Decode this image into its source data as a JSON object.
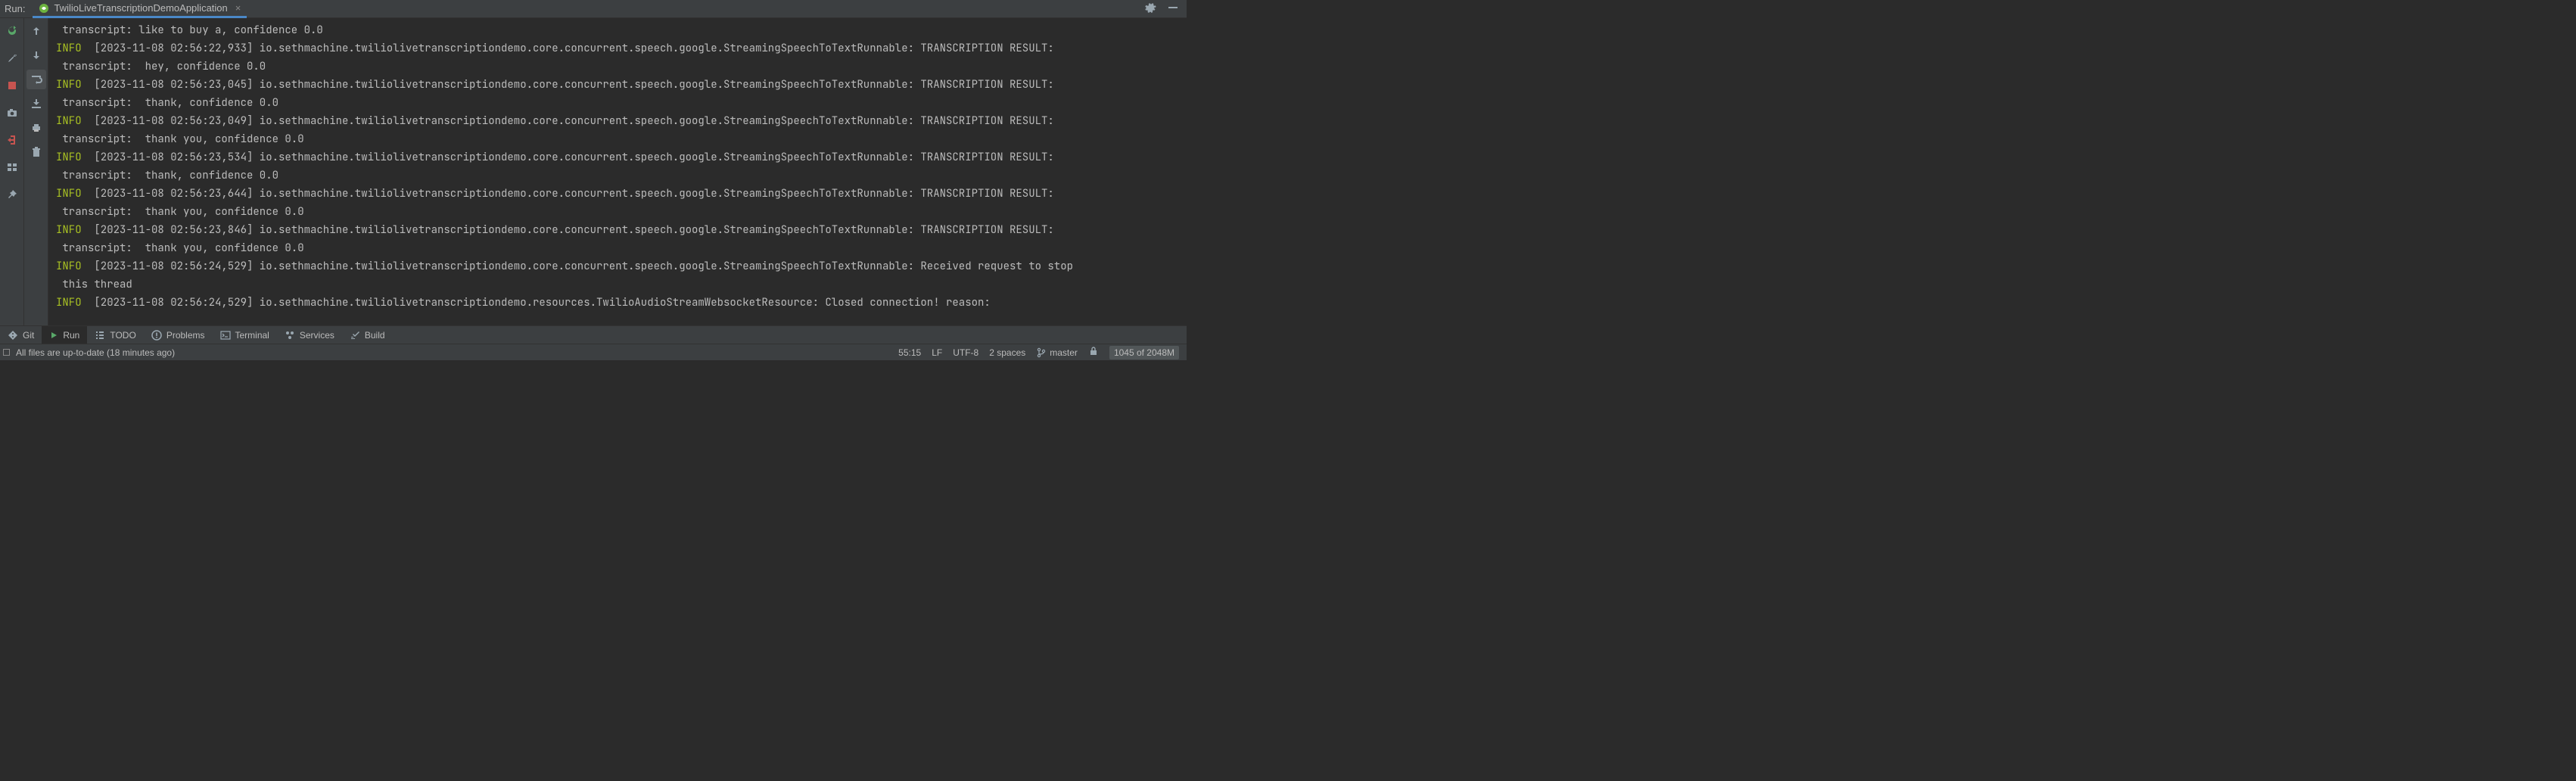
{
  "header": {
    "run_label": "Run:",
    "tab_title": "TwilioLiveTranscriptionDemoApplication"
  },
  "console": {
    "logger_class": "io.sethmachine.twiliolivetranscriptiondemo.core.concurrent.speech.google.StreamingSpeechToTextRunnable",
    "websocket_class": "io.sethmachine.twiliolivetranscriptiondemo.resources.TwilioAudioStreamWebsocketResource",
    "lines": [
      {
        "type": "cont",
        "text": " transcript: like to buy a, confidence 0.0"
      },
      {
        "type": "info",
        "ts": "[2023-11-08 02:56:22,933]",
        "suffix": ": TRANSCRIPTION RESULT:"
      },
      {
        "type": "cont",
        "text": " transcript:  hey, confidence 0.0"
      },
      {
        "type": "info",
        "ts": "[2023-11-08 02:56:23,045]",
        "suffix": ": TRANSCRIPTION RESULT:"
      },
      {
        "type": "cont",
        "text": " transcript:  thank, confidence 0.0"
      },
      {
        "type": "info",
        "ts": "[2023-11-08 02:56:23,049]",
        "suffix": ": TRANSCRIPTION RESULT:"
      },
      {
        "type": "cont",
        "text": " transcript:  thank you, confidence 0.0"
      },
      {
        "type": "info",
        "ts": "[2023-11-08 02:56:23,534]",
        "suffix": ": TRANSCRIPTION RESULT:"
      },
      {
        "type": "cont",
        "text": " transcript:  thank, confidence 0.0"
      },
      {
        "type": "info",
        "ts": "[2023-11-08 02:56:23,644]",
        "suffix": ": TRANSCRIPTION RESULT:"
      },
      {
        "type": "cont",
        "text": " transcript:  thank you, confidence 0.0"
      },
      {
        "type": "info",
        "ts": "[2023-11-08 02:56:23,846]",
        "suffix": ": TRANSCRIPTION RESULT:"
      },
      {
        "type": "cont",
        "text": " transcript:  thank you, confidence 0.0"
      },
      {
        "type": "info",
        "ts": "[2023-11-08 02:56:24,529]",
        "suffix": ": Received request to stop"
      },
      {
        "type": "cont",
        "text": " this thread"
      },
      {
        "type": "info_ws",
        "ts": "[2023-11-08 02:56:24,529]",
        "suffix": ": Closed connection! reason:"
      }
    ]
  },
  "bottom_tabs": {
    "git": "Git",
    "run": "Run",
    "todo": "TODO",
    "problems": "Problems",
    "terminal": "Terminal",
    "services": "Services",
    "build": "Build"
  },
  "status": {
    "message": "All files are up-to-date (18 minutes ago)",
    "position": "55:15",
    "line_sep": "LF",
    "encoding": "UTF-8",
    "indent": "2 spaces",
    "branch": "master",
    "memory": "1045 of 2048M"
  }
}
